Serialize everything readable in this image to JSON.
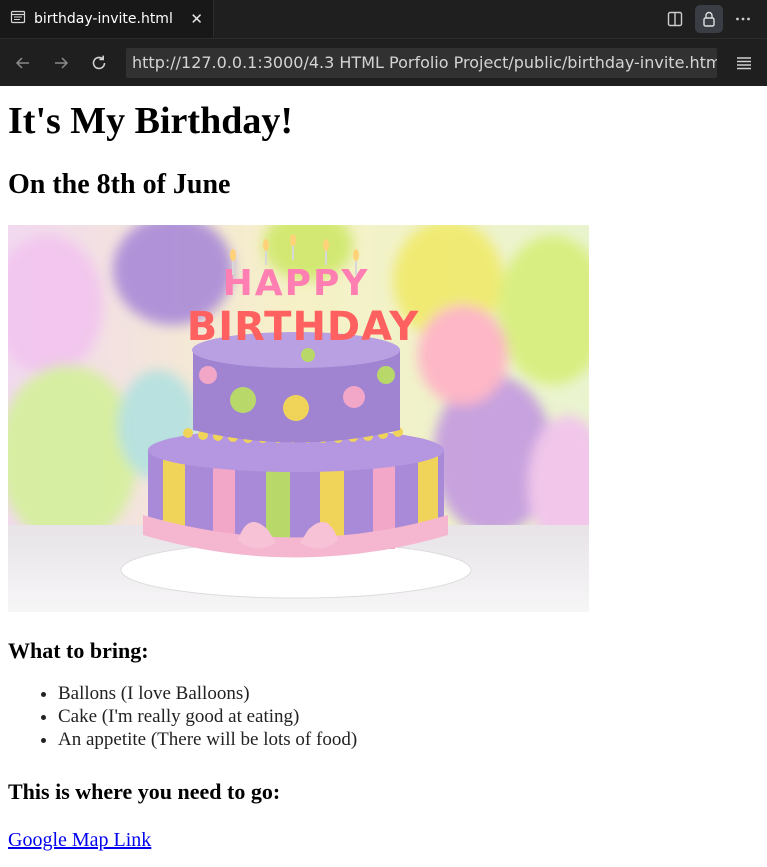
{
  "browser": {
    "tab": {
      "label": "birthday-invite.html"
    },
    "url": "http://127.0.0.1:3000/4.3 HTML Porfolio Project/public/birthday-invite.html"
  },
  "page": {
    "title": "It's My Birthday!",
    "subtitle": "On the 8th of June",
    "image": {
      "cake_text": "HAPPY BIRTHDAY"
    },
    "bring_heading": "What to bring:",
    "bring_items": [
      "Ballons (I love Balloons)",
      "Cake (I'm really good at eating)",
      "An appetite (There will be lots of food)"
    ],
    "where_heading": "This is where you need to go:",
    "map_link": "Google Map Link"
  },
  "icons": [
    "page-icon",
    "close-icon",
    "split-view-icon",
    "lock-icon",
    "more-icon",
    "back-icon",
    "forward-icon",
    "reload-icon",
    "menu-icon"
  ]
}
